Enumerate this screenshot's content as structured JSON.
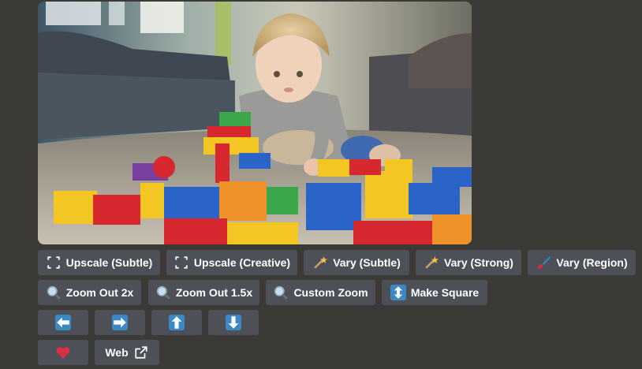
{
  "image": {
    "subject": "toddler playing with colorful building bricks on a carpet"
  },
  "buttons": {
    "row1": [
      {
        "label": "Upscale (Subtle)",
        "icon": "expand-arrows-icon"
      },
      {
        "label": "Upscale (Creative)",
        "icon": "expand-arrows-icon"
      },
      {
        "label": "Vary (Subtle)",
        "icon": "magic-wand-icon"
      },
      {
        "label": "Vary (Strong)",
        "icon": "magic-wand-icon"
      },
      {
        "label": "Vary (Region)",
        "icon": "paintbrush-icon"
      }
    ],
    "row2": [
      {
        "label": "Zoom Out 2x",
        "icon": "magnifier-icon"
      },
      {
        "label": "Zoom Out 1.5x",
        "icon": "magnifier-icon"
      },
      {
        "label": "Custom Zoom",
        "icon": "magnifier-icon"
      },
      {
        "label": "Make Square",
        "icon": "up-down-arrow-icon"
      }
    ],
    "row3": [
      {
        "icon": "arrow-left-icon"
      },
      {
        "icon": "arrow-right-icon"
      },
      {
        "icon": "arrow-up-icon"
      },
      {
        "icon": "arrow-down-icon"
      }
    ],
    "row4": [
      {
        "icon": "heart-icon"
      },
      {
        "label": "Web",
        "icon": "external-link-icon"
      }
    ]
  },
  "colors": {
    "background": "#3b3a36",
    "button": "#4e5058",
    "arrow_blue": "#3b88c3",
    "heart_red": "#dd2e44"
  }
}
